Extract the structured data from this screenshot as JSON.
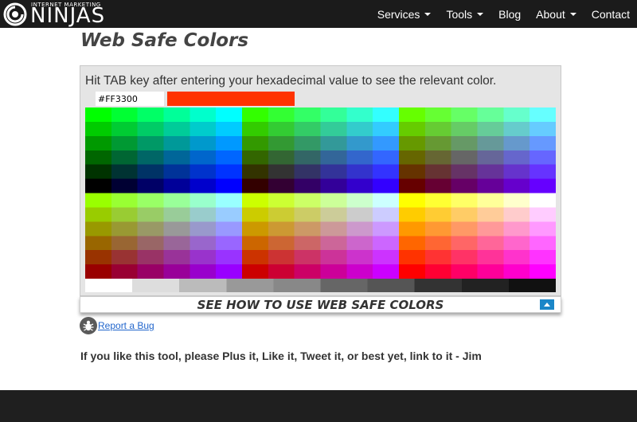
{
  "header": {
    "logo_small": "INTERNET MARKETING",
    "logo_big": "NINJAS",
    "logo_icon": "swirl-logo-icon",
    "nav": [
      {
        "label": "Services",
        "dropdown": true
      },
      {
        "label": "Tools",
        "dropdown": true
      },
      {
        "label": "Blog",
        "dropdown": false
      },
      {
        "label": "About",
        "dropdown": true
      },
      {
        "label": "Contact",
        "dropdown": false
      }
    ]
  },
  "page": {
    "title": "Web Safe Colors",
    "instruction": "Hit TAB key after entering your hexadecimal value to see the relevant color.",
    "hex_value": "#FF3300",
    "swatch_color": "#FF3300",
    "palette": {
      "steps": [
        "00",
        "33",
        "66",
        "99",
        "CC",
        "FF"
      ],
      "grays": [
        "#FFFFFF",
        "#DDDDDD",
        "#BBBBBB",
        "#999999",
        "#888888",
        "#666666",
        "#555555",
        "#333333",
        "#222222",
        "#111111"
      ]
    },
    "howto_label": "SEE HOW TO USE WEB SAFE COLORS",
    "bug_label": "Report a Bug",
    "footer_message": "If you like this tool, please Plus it, Like it, Tweet it, or best yet, link to it - Jim"
  },
  "colors": {
    "header_bg": "#1B1B1B",
    "panel_bg": "#E5E5E5",
    "accent_blue": "#1A86C8",
    "link": "#2266CC"
  }
}
